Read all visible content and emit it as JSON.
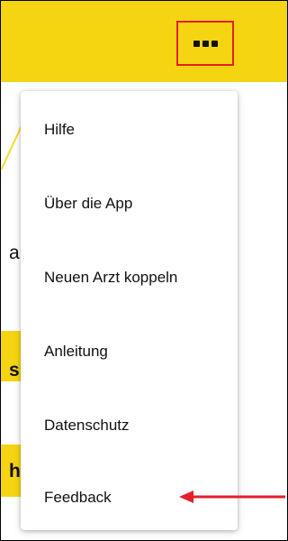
{
  "toolbar": {
    "more_icon": "more-horizontal-icon",
    "background_color": "#f5d511",
    "highlight_color": "#e41f2a"
  },
  "background": {
    "partial_texts": [
      "a",
      "s",
      "h"
    ]
  },
  "menu": {
    "items": [
      {
        "label": "Hilfe"
      },
      {
        "label": "Über die App"
      },
      {
        "label": "Neuen Arzt koppeln"
      },
      {
        "label": "Anleitung"
      },
      {
        "label": "Datenschutz"
      },
      {
        "label": "Feedback"
      }
    ]
  },
  "annotation": {
    "arrow_icon": "left-arrow-icon",
    "arrow_color": "#e41f2a"
  }
}
